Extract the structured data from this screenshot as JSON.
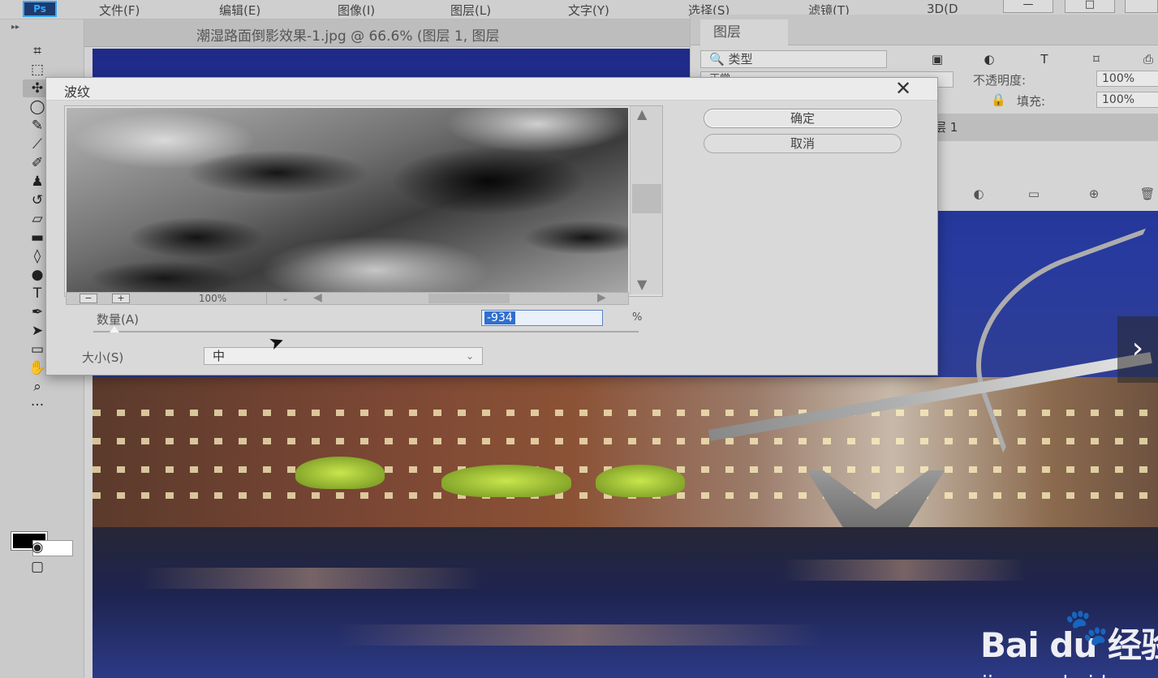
{
  "app": {
    "logo": "Ps"
  },
  "menu": [
    "文件(F)",
    "编辑(E)",
    "图像(I)",
    "图层(L)",
    "文字(Y)",
    "选择(S)",
    "滤镜(T)",
    "3D(D"
  ],
  "window_controls": {
    "minimize": "—",
    "restore": "□"
  },
  "document": {
    "title": "潮湿路面倒影效果-1.jpg @ 66.6% (图层 1, 图层"
  },
  "tools": [
    {
      "name": "crop-icon",
      "glyph": "⌗"
    },
    {
      "name": "marquee-icon",
      "glyph": "⬚"
    },
    {
      "name": "move-icon",
      "glyph": "✣"
    },
    {
      "name": "lasso-icon",
      "glyph": "◯"
    },
    {
      "name": "quick-select-icon",
      "glyph": "✎"
    },
    {
      "name": "eyedropper-icon",
      "glyph": "⟋"
    },
    {
      "name": "brush-icon",
      "glyph": "✐"
    },
    {
      "name": "stamp-icon",
      "glyph": "♟"
    },
    {
      "name": "history-brush-icon",
      "glyph": "↺"
    },
    {
      "name": "eraser-icon",
      "glyph": "▱"
    },
    {
      "name": "gradient-icon",
      "glyph": "▬"
    },
    {
      "name": "blur-icon",
      "glyph": "◊"
    },
    {
      "name": "dodge-icon",
      "glyph": "●"
    },
    {
      "name": "type-tool-icon",
      "glyph": "T"
    },
    {
      "name": "pen-icon",
      "glyph": "✒"
    },
    {
      "name": "path-select-icon",
      "glyph": "➤"
    },
    {
      "name": "rectangle-icon",
      "glyph": "▭"
    },
    {
      "name": "hand-icon",
      "glyph": "✋"
    },
    {
      "name": "zoom-tool-icon",
      "glyph": "⌕"
    },
    {
      "name": "more-tools-icon",
      "glyph": "···"
    }
  ],
  "layers_panel": {
    "tab": "图层",
    "filter_type": "🔍 类型",
    "blend_mode": "正常",
    "opacity_label": "不透明度:",
    "opacity_value": "100%",
    "fill_label": "填充:",
    "fill_value": "100%",
    "layer_name": "层 1",
    "filter_icons": [
      "▣",
      "◐",
      "T",
      "⌑",
      "⎙"
    ],
    "bottom_icons": [
      "◐",
      "▭",
      "⊕",
      "🗑"
    ]
  },
  "dialog": {
    "title": "波纹",
    "close": "✕",
    "ok": "确定",
    "cancel": "取消",
    "zoom_out": "−",
    "zoom_in": "+",
    "zoom": "100%",
    "amount_label": "数量(A)",
    "amount_value": "-934",
    "amount_unit": "%",
    "amount_level": 0.03,
    "size_label": "大小(S)",
    "size_value": "中"
  },
  "watermark": {
    "brand": "Bai  du 经验",
    "paw": "🐾",
    "url": "jingyan.baidu.com"
  },
  "nav": {
    "next": "›"
  }
}
